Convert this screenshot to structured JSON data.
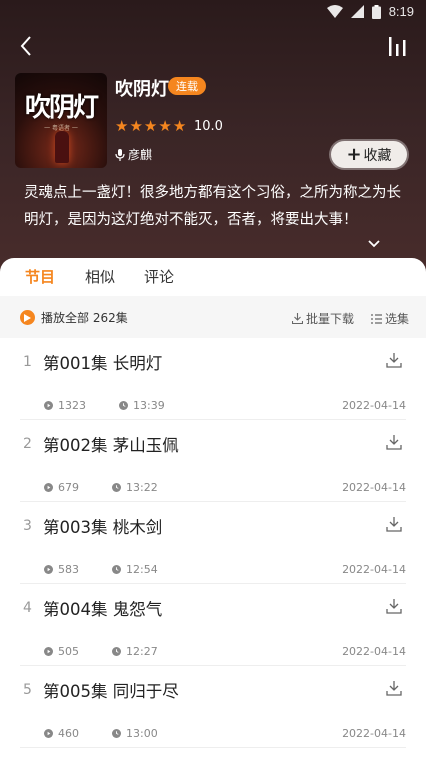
{
  "status": {
    "time": "8:19"
  },
  "album": {
    "cover_title": "吹阴灯",
    "cover_subtitle": "一 粤语者 一",
    "title": "吹阴灯",
    "badge": "连载",
    "rating": 5,
    "score": "10.0",
    "author": "彦麒",
    "collect_label": "收藏",
    "description": "灵魂点上一盏灯！很多地方都有这个习俗，之所为称之为长明灯，是因为这灯绝对不能灭，否者，将要出大事！"
  },
  "tabs": [
    {
      "label": "节目"
    },
    {
      "label": "相似"
    },
    {
      "label": "评论"
    }
  ],
  "toolbar": {
    "play_all_label": "播放全部 262集",
    "batch_download_label": "批量下载",
    "select_label": "选集"
  },
  "episodes": [
    {
      "num": "1",
      "title": "第001集 长明灯",
      "plays": "1323",
      "duration": "13:39",
      "date": "2022-04-14"
    },
    {
      "num": "2",
      "title": "第002集 茅山玉佩",
      "plays": "679",
      "duration": "13:22",
      "date": "2022-04-14"
    },
    {
      "num": "3",
      "title": "第003集 桃木剑",
      "plays": "583",
      "duration": "12:54",
      "date": "2022-04-14"
    },
    {
      "num": "4",
      "title": "第004集 鬼怨气",
      "plays": "505",
      "duration": "12:27",
      "date": "2022-04-14"
    },
    {
      "num": "5",
      "title": "第005集 同归于尽",
      "plays": "460",
      "duration": "13:00",
      "date": "2022-04-14"
    }
  ],
  "colors": {
    "accent": "#f5861f",
    "hero_bg": "#3a2526"
  }
}
